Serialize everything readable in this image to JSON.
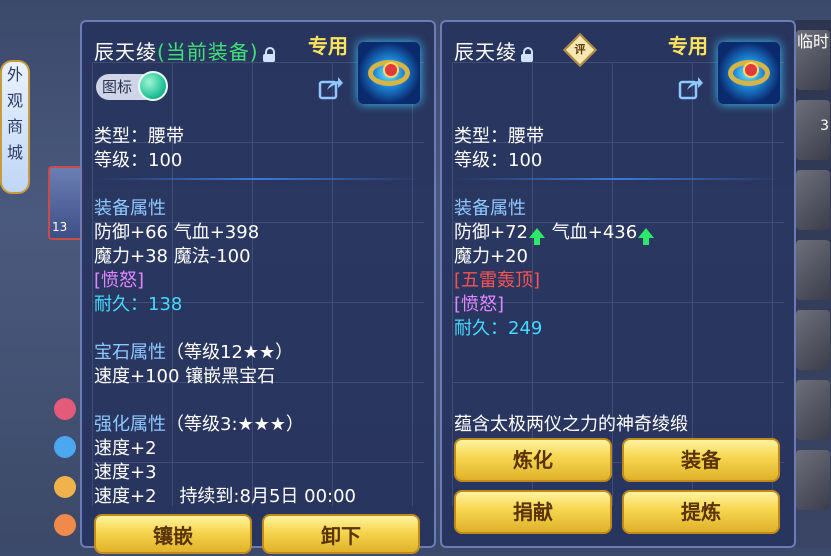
{
  "background": {
    "left_banner_chars": [
      "外",
      "观",
      "商",
      "城"
    ],
    "avatar_level": "13",
    "right_label": "临时",
    "right_num": "3"
  },
  "current": {
    "title_name": "辰天绫",
    "title_tag": "(当前装备)",
    "dedicated": "专用",
    "icon_badge": "图标",
    "type": "类型：腰带",
    "level": "等级：100",
    "equip_attr_header": "装备属性",
    "attr_line1": "防御+66 气血+398",
    "attr_line2": "魔力+38 魔法-100",
    "special": "[愤怒]",
    "durability_label": "耐久：",
    "durability_value": "138",
    "gem_header": "宝石属性",
    "gem_level": "（等级12★★）",
    "gem_line": "速度+100 镶嵌黑宝石",
    "enhance_header": "强化属性",
    "enhance_level": "（等级3:★★★）",
    "enhance_line1": "速度+2",
    "enhance_line2": "速度+3",
    "enhance_line3": "速度+2",
    "enhance_duration": "持续到:8月5日 00:00",
    "btn_inlay": "镶嵌",
    "btn_unload": "卸下"
  },
  "compare": {
    "title_name": "辰天绫",
    "eval_label": "评",
    "dedicated": "专用",
    "type": "类型：腰带",
    "level": "等级：100",
    "equip_attr_header": "装备属性",
    "attr_def": "防御+72",
    "attr_hp": "气血+436",
    "attr_line2": "魔力+20",
    "special1": "[五雷轰顶]",
    "special2": "[愤怒]",
    "durability_label": "耐久：",
    "durability_value": "249",
    "description": "蕴含太极两仪之力的神奇绫缎",
    "btn_refine": "炼化",
    "btn_equip": "装备",
    "btn_donate": "捐献",
    "btn_extract": "提炼"
  },
  "colors": {
    "title_green": "#3fe07a",
    "dedicated_yellow": "#ffe35a",
    "section_blue": "#8ec8ff",
    "special_purple": "#e088ff",
    "special_red": "#ff5252",
    "durability_cyan": "#45d9ff",
    "up_arrow_green": "#2ee86a"
  }
}
